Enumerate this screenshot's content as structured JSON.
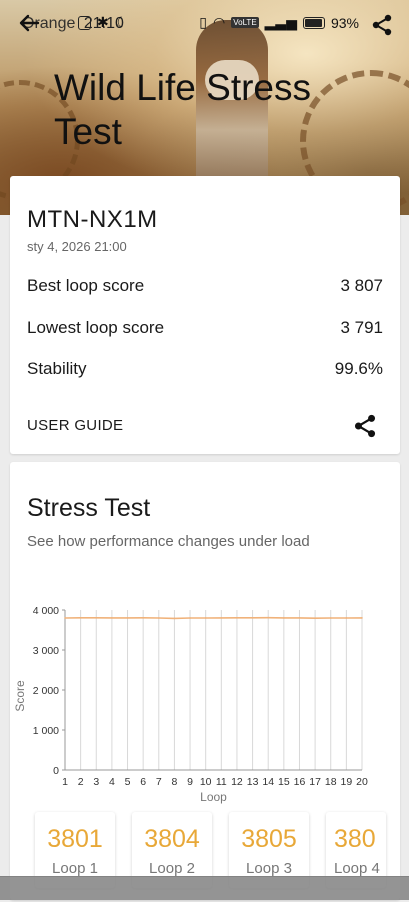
{
  "status": {
    "carrier": "Orange",
    "time": "21:10",
    "volte": "VoLTE",
    "battery": "93%"
  },
  "hero": {
    "title": "Wild Life Stress Test"
  },
  "result": {
    "device": "MTN-NX1M",
    "date": "sty 4, 2026 21:00",
    "best_label": "Best loop score",
    "best_value": "3 807",
    "lowest_label": "Lowest loop score",
    "lowest_value": "3 791",
    "stability_label": "Stability",
    "stability_value": "99.6%",
    "guide": "USER GUIDE"
  },
  "stress": {
    "title": "Stress Test",
    "subtitle": "See how performance changes under load"
  },
  "loop_cards": [
    {
      "value": "3801",
      "label": "Loop 1"
    },
    {
      "value": "3804",
      "label": "Loop 2"
    },
    {
      "value": "3805",
      "label": "Loop 3"
    },
    {
      "value": "380",
      "label": "Loop 4"
    }
  ],
  "colors": {
    "accent": "#e8a838",
    "line": "#f0b27a"
  },
  "chart_data": {
    "type": "line",
    "ylabel": "Score",
    "xlabel": "Loop",
    "ylim": [
      0,
      4000
    ],
    "yticks": [
      "0",
      "1 000",
      "2 000",
      "3 000",
      "4 000"
    ],
    "ytick_values": [
      0,
      1000,
      2000,
      3000,
      4000
    ],
    "x": [
      1,
      2,
      3,
      4,
      5,
      6,
      7,
      8,
      9,
      10,
      11,
      12,
      13,
      14,
      15,
      16,
      17,
      18,
      19,
      20
    ],
    "series": [
      {
        "values": [
          3801,
          3804,
          3805,
          3803,
          3802,
          3804,
          3800,
          3791,
          3799,
          3801,
          3803,
          3804,
          3805,
          3807,
          3802,
          3803,
          3796,
          3800,
          3801,
          3802
        ]
      }
    ],
    "grid": true
  }
}
